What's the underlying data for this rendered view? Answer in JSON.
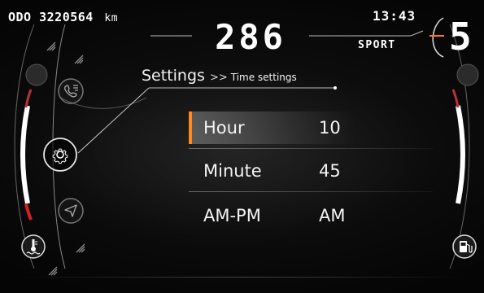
{
  "status": {
    "odometer_label": "ODO",
    "odometer_value": "3220564",
    "odometer_unit": "km",
    "clock": "13:43",
    "speed": "286",
    "ride_mode": "SPORT",
    "gear": "5"
  },
  "breadcrumb": {
    "title": "Settings",
    "separator": ">>",
    "current": "Time settings"
  },
  "settings_rows": [
    {
      "label": "Hour",
      "value": "10",
      "active": true
    },
    {
      "label": "Minute",
      "value": "45",
      "active": false
    },
    {
      "label": "AM-PM",
      "value": "AM",
      "active": false
    }
  ],
  "side_menu": {
    "icons": [
      "phone-icon",
      "settings-gear-icon",
      "navigation-icon"
    ]
  },
  "gauges": {
    "left_icon": "coolant-temperature-icon",
    "right_icon": "fuel-pump-icon"
  },
  "colors": {
    "accent": "#ff8a1e",
    "gear_ring_accent": "#ff7a1a",
    "background": "#0a0a0a",
    "text": "#f4f4f4"
  }
}
